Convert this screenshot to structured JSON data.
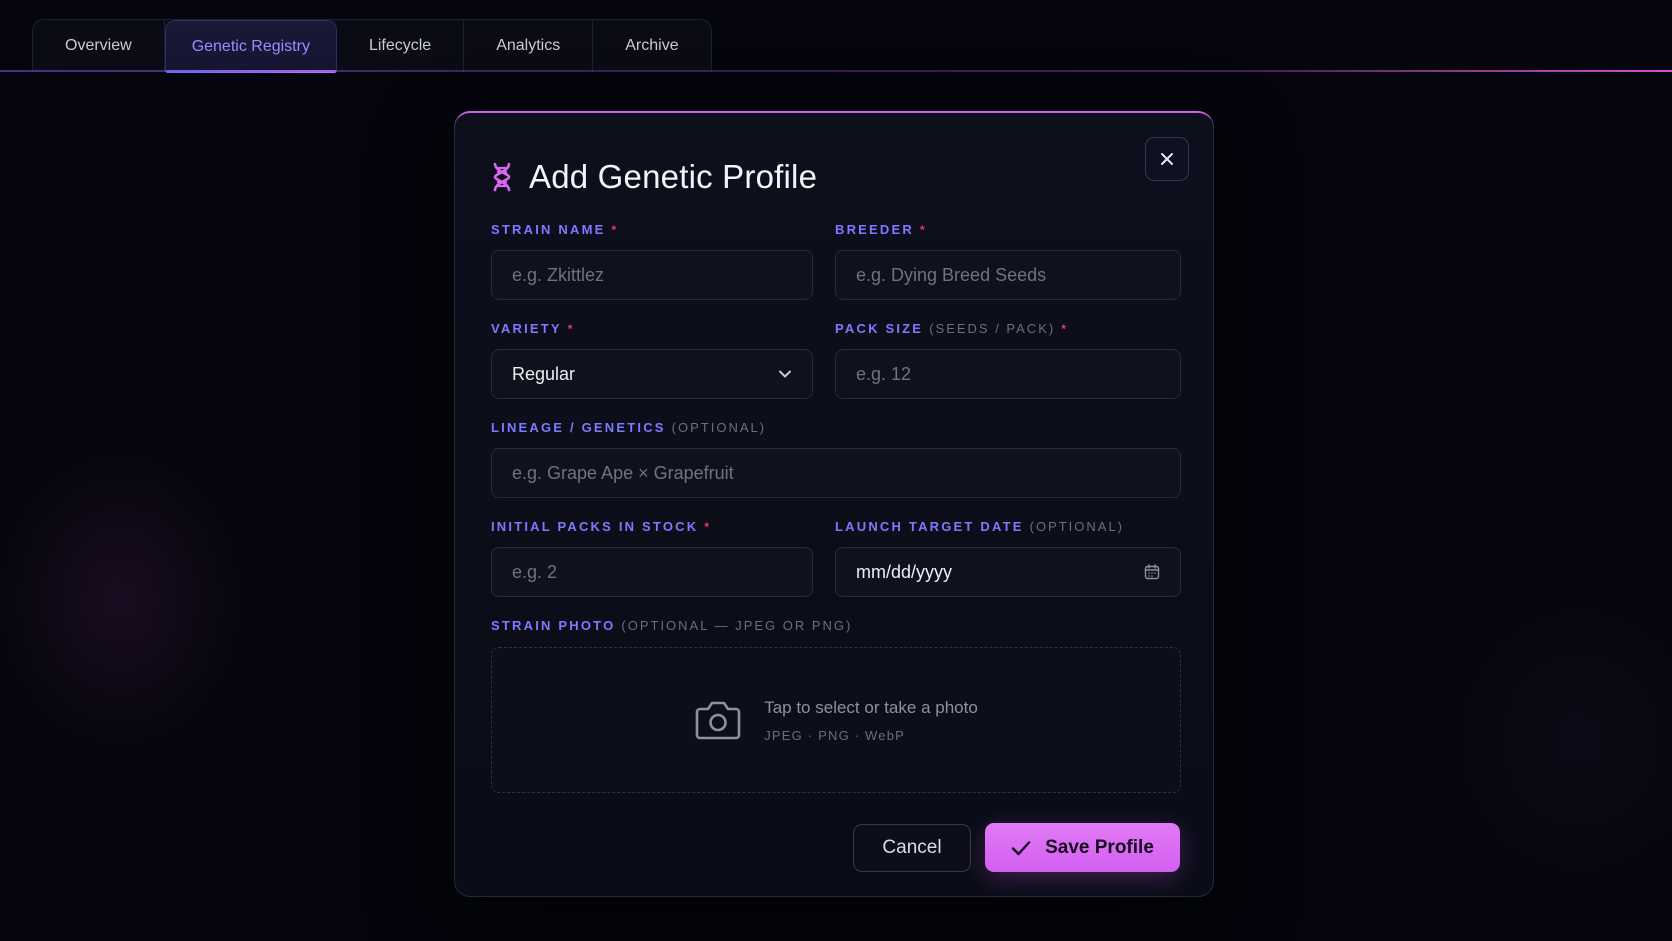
{
  "tabs": [
    {
      "label": "Overview",
      "active": false
    },
    {
      "label": "Genetic Registry",
      "active": true
    },
    {
      "label": "Lifecycle",
      "active": false
    },
    {
      "label": "Analytics",
      "active": false
    },
    {
      "label": "Archive",
      "active": false
    }
  ],
  "modal": {
    "title": "Add Genetic Profile",
    "title_icon": "dna-icon",
    "close_icon": "close-icon",
    "fields": {
      "strain_name": {
        "label": "STRAIN NAME",
        "required_mark": "*",
        "placeholder": "e.g. Zkittlez"
      },
      "breeder": {
        "label": "BREEDER",
        "required_mark": "*",
        "placeholder": "e.g. Dying Breed Seeds"
      },
      "variety": {
        "label": "VARIETY",
        "required_mark": "*",
        "value": "Regular"
      },
      "pack_size": {
        "label": "PACK SIZE",
        "hint": "(SEEDS / PACK)",
        "required_mark": "*",
        "placeholder": "e.g. 12"
      },
      "lineage": {
        "label": "LINEAGE / GENETICS",
        "hint": "(OPTIONAL)",
        "placeholder": "e.g. Grape Ape × Grapefruit"
      },
      "initial_packs": {
        "label": "INITIAL PACKS IN STOCK",
        "required_mark": "*",
        "placeholder": "e.g. 2"
      },
      "launch_date": {
        "label": "LAUNCH TARGET DATE",
        "hint": "(OPTIONAL)",
        "value": "mm/dd/yyyy"
      },
      "photo": {
        "label": "STRAIN PHOTO",
        "hint": "(OPTIONAL — JPEG OR PNG)",
        "dropzone_text": "Tap to select or take a photo",
        "dropzone_formats": "JPEG · PNG · WebP"
      }
    },
    "actions": {
      "cancel_label": "Cancel",
      "save_label": "Save Profile"
    }
  },
  "colors": {
    "accent": "#7e79ff",
    "save_button": "#d96af3",
    "required": "#e0405c",
    "background": "#05060d"
  }
}
